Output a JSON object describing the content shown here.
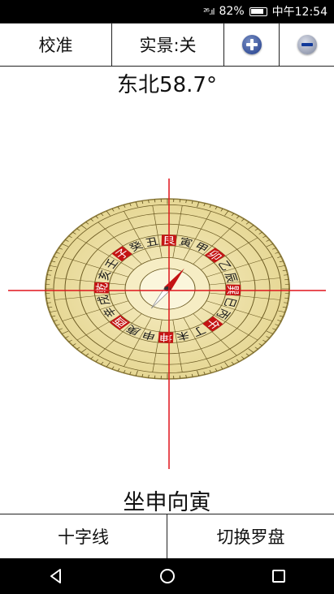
{
  "status": {
    "signal": "²⁶.ıl",
    "battery": "82%",
    "time": "中午12:54"
  },
  "toolbar": {
    "calibrate": "校准",
    "live_view": "实景:关",
    "zoom_in_icon": "plus-circle-icon",
    "zoom_out_icon": "minus-circle-icon"
  },
  "direction": "东北58.7°",
  "compass": {
    "heading_degrees": 58.7,
    "crosshair": true,
    "colors": {
      "dial": "#efe3a8",
      "red": "#c41414",
      "crosshair": "#e0141b"
    },
    "labels": [
      "壬",
      "子",
      "癸",
      "丑",
      "艮",
      "寅",
      "甲",
      "卯",
      "乙",
      "辰",
      "巽",
      "巳",
      "丙",
      "午",
      "丁",
      "未",
      "坤",
      "申",
      "庚",
      "酉",
      "辛",
      "戌",
      "乾",
      "亥"
    ]
  },
  "sitting": "坐申向寅",
  "bottom": {
    "crosshair": "十字线",
    "switch_dial": "切换罗盘"
  },
  "nav": {
    "back_icon": "back-triangle-icon",
    "home_icon": "home-circle-icon",
    "recents_icon": "recents-square-icon"
  }
}
